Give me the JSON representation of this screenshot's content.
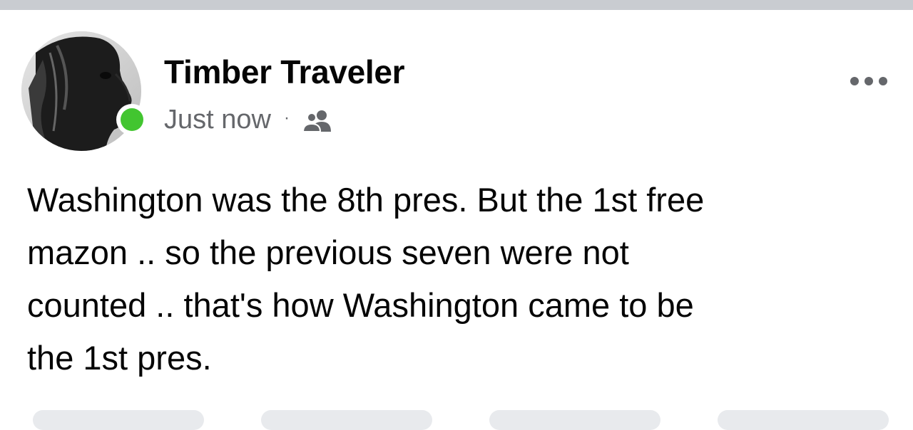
{
  "post": {
    "author_name": "Timber Traveler",
    "timestamp": "Just now",
    "separator": "·",
    "audience_icon": "friends-group-icon",
    "more_icon": "more-dots-icon",
    "online_status_color": "#42c530",
    "text_lines": [
      "Washington was the 8th pres. But the 1st free",
      "mazon .. so the previous seven were not",
      "counted .. that's how Washington came to be",
      "the 1st pres."
    ]
  }
}
